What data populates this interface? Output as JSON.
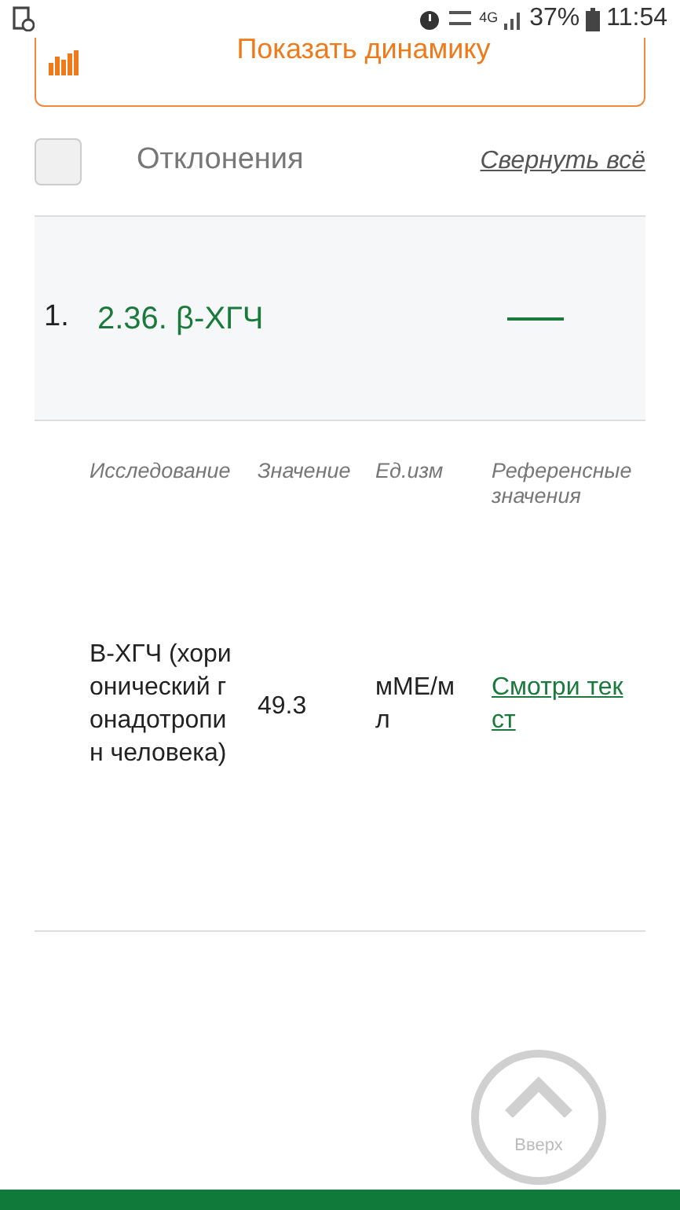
{
  "status_bar": {
    "network": "4G",
    "battery": "37%",
    "time": "11:54"
  },
  "dynamics_button": {
    "label": "Показать динамику"
  },
  "filter": {
    "checked": false,
    "label": "Отклонения",
    "collapse_link": "Свернуть всё"
  },
  "sections": [
    {
      "number": "1.",
      "title": "2.36. β-ХГЧ",
      "expanded": true,
      "columns": [
        "Исследование",
        "Значение",
        "Ед.изм",
        "Референсные значения"
      ],
      "rows": [
        {
          "test": "В-ХГЧ (хорионический гонадотропин человека)",
          "value": "49.3",
          "unit": "мМЕ/мл",
          "reference": "Смотри текст"
        }
      ]
    }
  ],
  "scroll_top": {
    "label": "Вверх"
  }
}
